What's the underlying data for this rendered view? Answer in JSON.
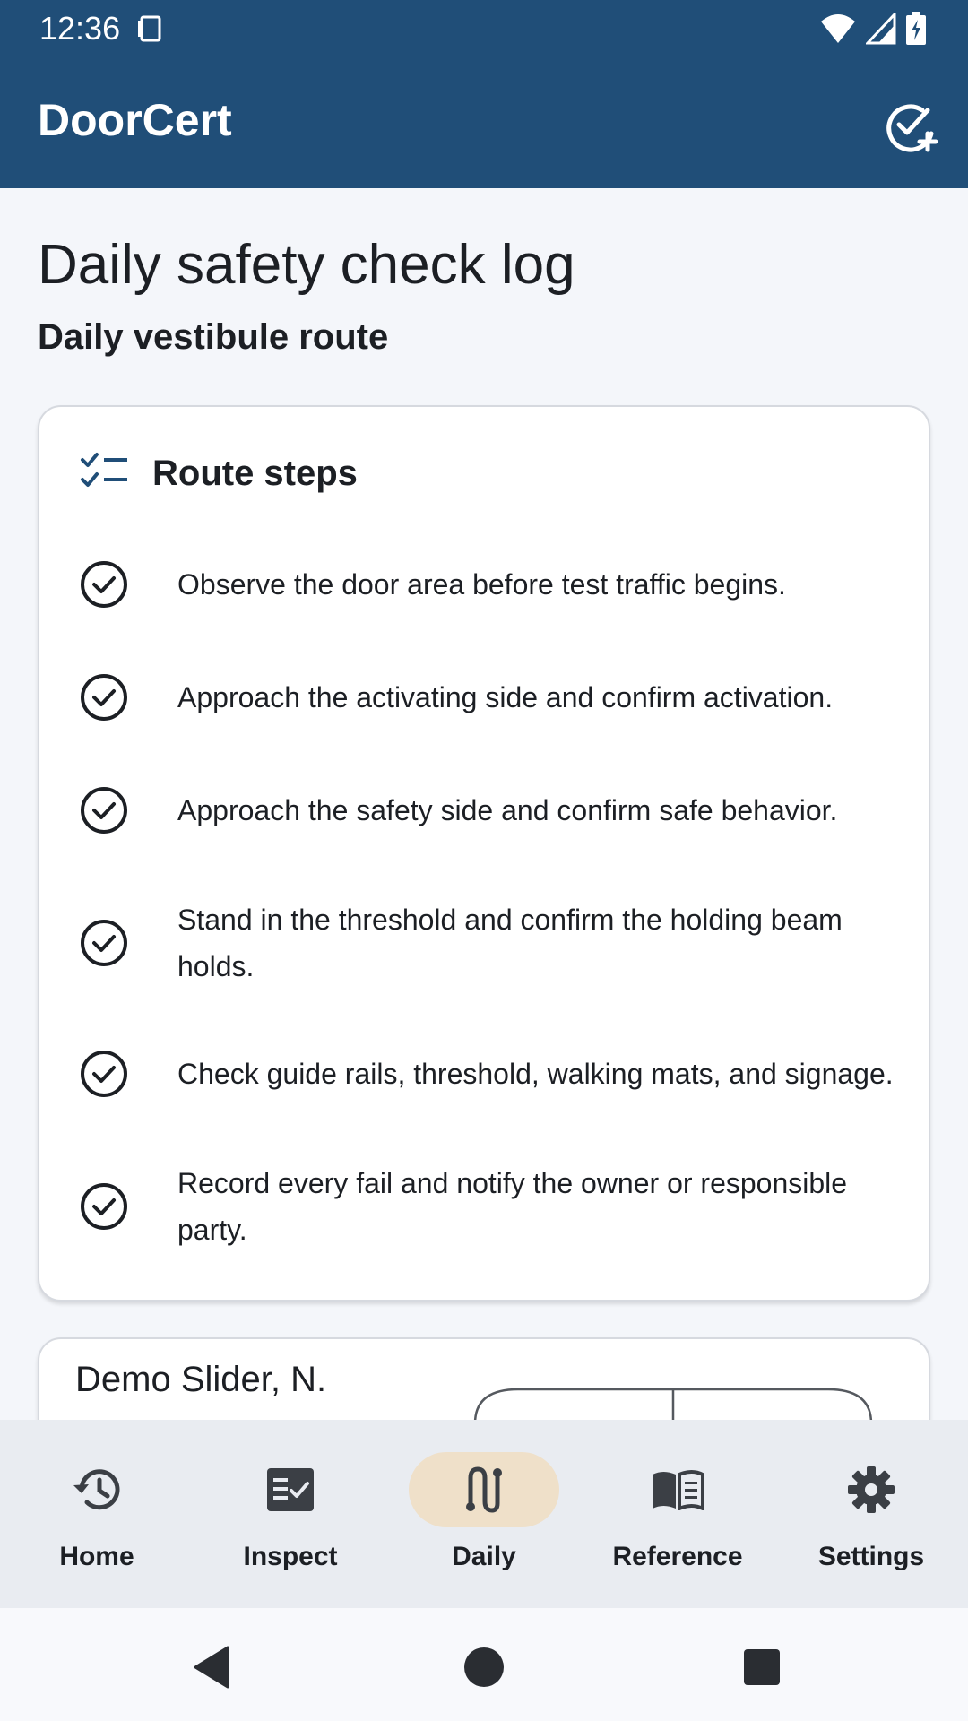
{
  "status": {
    "time": "12:36"
  },
  "app": {
    "title": "DoorCert",
    "action_icon": "check-add-icon"
  },
  "page": {
    "title": "Daily safety check log",
    "subtitle": "Daily vestibule route"
  },
  "steps_card": {
    "title": "Route steps",
    "icon": "checklist-icon",
    "steps": [
      "Observe the door area before test traffic begins.",
      "Approach the activating side and confirm activation.",
      "Approach the safety side and confirm safe behavior.",
      "Stand in the threshold and confirm the holding beam holds.",
      "Check guide rails, threshold, walking mats, and signage.",
      "Record every fail and notify the owner or responsible party."
    ]
  },
  "demo_card": {
    "title": "Demo Slider, N."
  },
  "bottom_nav": {
    "items": [
      {
        "label": "Home",
        "icon": "history-icon",
        "active": false
      },
      {
        "label": "Inspect",
        "icon": "checklist-box-icon",
        "active": false
      },
      {
        "label": "Daily",
        "icon": "route-icon",
        "active": true
      },
      {
        "label": "Reference",
        "icon": "book-icon",
        "active": false
      },
      {
        "label": "Settings",
        "icon": "gear-icon",
        "active": false
      }
    ]
  },
  "colors": {
    "primary": "#204e78",
    "active_pill": "#efe0c9",
    "nav_background": "#e9ecf1"
  }
}
